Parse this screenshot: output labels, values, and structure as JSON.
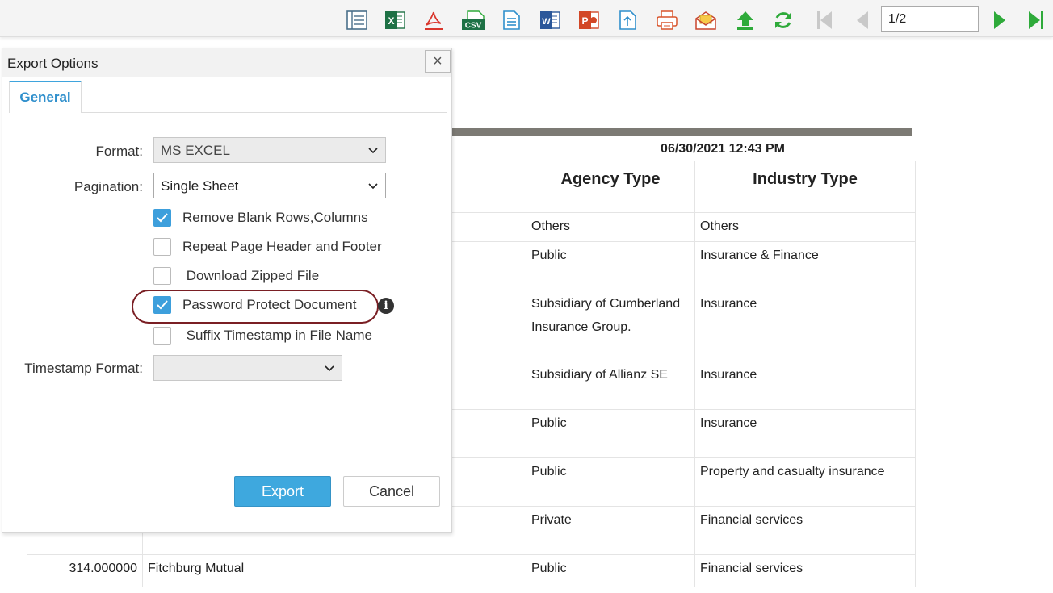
{
  "toolbar": {
    "icons": [
      "table-view-icon",
      "excel-icon",
      "pdf-icon",
      "csv-icon",
      "text-icon",
      "word-icon",
      "powerpoint-icon",
      "upload-file-icon",
      "print-icon",
      "email-icon",
      "upload-icon",
      "refresh-icon",
      "first-page-icon",
      "prev-page-icon",
      "next-page-icon",
      "last-page-icon"
    ],
    "csv_label": "CSV",
    "page_value": "1/2",
    "colors": {
      "excel": "#1e7145",
      "pdf": "#d9362c",
      "word": "#2b579a",
      "ppt": "#d24726",
      "green": "#2eaa3a",
      "doc_blue": "#2f8fcc"
    }
  },
  "report": {
    "timestamp": "06/30/2021  12:43 PM",
    "headers": [
      "Agency Type",
      "Industry Type"
    ],
    "rows": [
      {
        "num": "",
        "name": "",
        "agency": "Others",
        "industry": "Others"
      },
      {
        "num": "",
        "name": "",
        "agency": "Public",
        "industry": "Insurance & Finance"
      },
      {
        "num": "",
        "name": "",
        "agency": "Subsidiary of Cumberland Insurance Group.",
        "industry": "Insurance"
      },
      {
        "num": "",
        "name": "",
        "agency": "Subsidiary of Allianz SE",
        "industry": "Insurance"
      },
      {
        "num": "",
        "name": "",
        "agency": "Public",
        "industry": "Insurance"
      },
      {
        "num": "",
        "name": "",
        "agency": "Public",
        "industry": "Property and casualty insurance"
      },
      {
        "num": "",
        "name": "",
        "agency": "Private",
        "industry": "Financial services"
      },
      {
        "num": "314.000000",
        "name": "Fitchburg Mutual",
        "agency": "Public",
        "industry": "Financial services"
      }
    ]
  },
  "dialog": {
    "title": "Export Options",
    "close_label": "×",
    "tab_label": "General",
    "format_label": "Format:",
    "format_value": "MS EXCEL",
    "pagination_label": "Pagination:",
    "pagination_value": "Single Sheet",
    "options": [
      {
        "label": "Remove Blank Rows,Columns",
        "checked": true
      },
      {
        "label": "Repeat Page Header and Footer",
        "checked": false
      },
      {
        "label": " Download Zipped File",
        "checked": false
      },
      {
        "label": "Password Protect Document",
        "checked": true
      },
      {
        "label": " Suffix Timestamp in File Name",
        "checked": false
      }
    ],
    "info_label": "i",
    "timestamp_format_label": "Timestamp Format:",
    "timestamp_format_value": "",
    "export_label": "Export",
    "cancel_label": "Cancel",
    "accent_color": "#3ea8de",
    "highlight_color": "#7a1f24"
  }
}
